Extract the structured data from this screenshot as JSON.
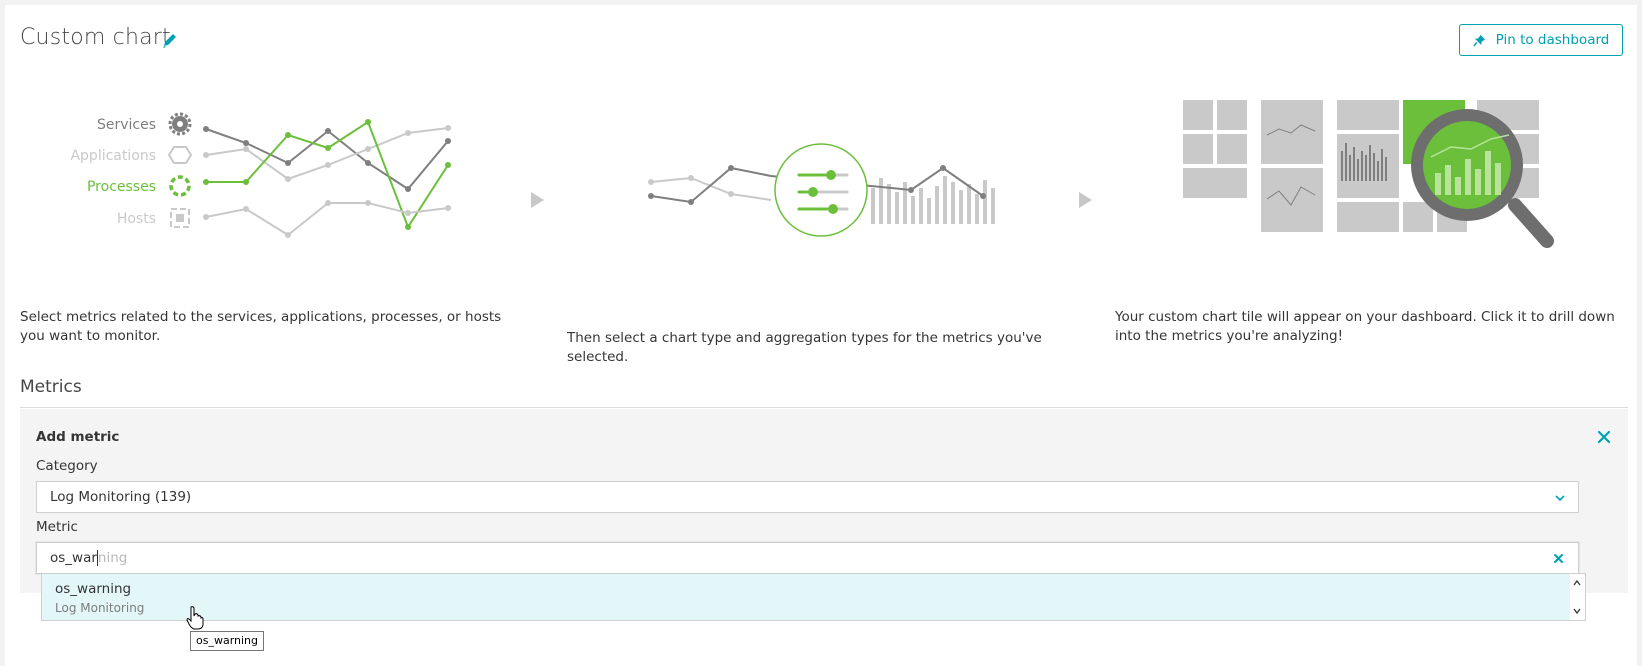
{
  "header": {
    "title": "Custom chart",
    "pin_button_label": "Pin to dashboard"
  },
  "illustration": {
    "entity_labels": [
      "Services",
      "Applications",
      "Processes",
      "Hosts"
    ]
  },
  "steps": [
    {
      "text": "Select metrics related to the services, applications, processes, or hosts you want to monitor."
    },
    {
      "text": "Then select a chart type and aggregation types for the metrics you've selected."
    },
    {
      "text": "Your custom chart tile will appear on your dashboard. Click it to drill down into the metrics you're analyzing!"
    }
  ],
  "metrics": {
    "section_title": "Metrics",
    "add_metric": {
      "title": "Add metric",
      "category_label": "Category",
      "category_value": "Log Monitoring (139)",
      "metric_label": "Metric",
      "metric_typed": "os_war",
      "metric_autocomplete": "ning",
      "suggestions": [
        {
          "name": "os_warning",
          "category": "Log Monitoring"
        }
      ]
    }
  },
  "tooltip": {
    "text": "os_warning"
  },
  "colors": {
    "accent": "#00a1b2",
    "green": "#6bbf3a",
    "dark_gray": "#7f7f7f",
    "light_gray": "#c9c9c9"
  }
}
